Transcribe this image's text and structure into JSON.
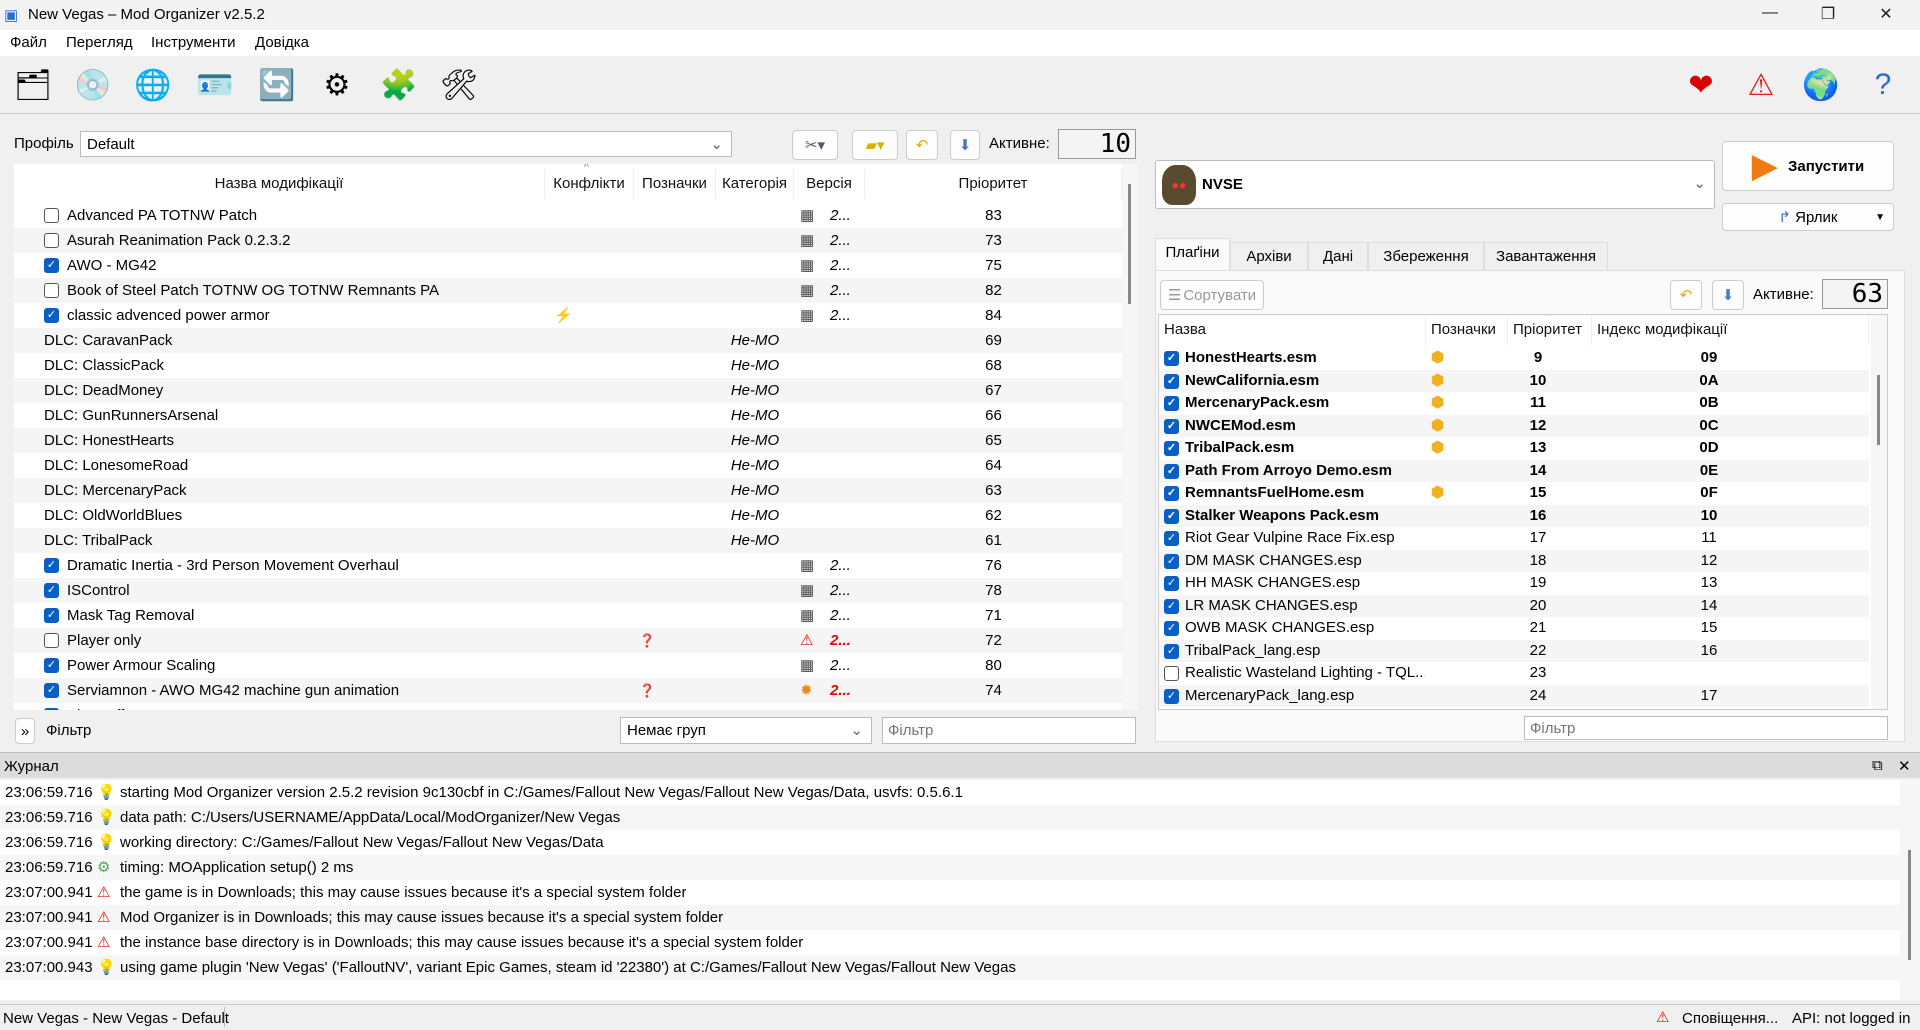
{
  "window": {
    "title": "New Vegas – Mod Organizer v2.5.2",
    "minimize": "—",
    "restore": "❐",
    "close": "✕"
  },
  "menu": [
    "Файл",
    "Перегляд",
    "Інструменти",
    "Довідка"
  ],
  "toolbar": {
    "left": [
      {
        "name": "instances-icon",
        "glyph": "🗂"
      },
      {
        "name": "install-mod-icon",
        "glyph": "💿"
      },
      {
        "name": "nexus-icon",
        "glyph": "🌐"
      },
      {
        "name": "profiles-icon",
        "glyph": "🪪"
      },
      {
        "name": "refresh-icon",
        "glyph": "🔄"
      },
      {
        "name": "executables-icon",
        "glyph": "⚙"
      },
      {
        "name": "tools-icon",
        "glyph": "🧩"
      },
      {
        "name": "settings-icon",
        "glyph": "🛠"
      }
    ],
    "right": [
      {
        "name": "endorse-icon",
        "glyph": "❤"
      },
      {
        "name": "notifications-icon",
        "glyph": "⚠"
      },
      {
        "name": "update-icon",
        "glyph": "🌍"
      },
      {
        "name": "help-icon",
        "glyph": "?"
      }
    ]
  },
  "profile": {
    "label": "Профіль",
    "value": "Default",
    "active_label": "Активне:",
    "active_count": "10"
  },
  "mods": {
    "columns": [
      "Назва модифікації",
      "Конфлікти",
      "Позначки",
      "Категорія",
      "Версія",
      "Пріоритет"
    ],
    "rows": [
      {
        "checked": false,
        "name": "Advanced PA TOTNW Patch",
        "version": "2...",
        "priority": "83"
      },
      {
        "checked": false,
        "name": "Asurah Reanimation Pack 0.2.3.2",
        "version": "2...",
        "priority": "73"
      },
      {
        "checked": true,
        "name": "AWO - MG42",
        "version": "2...",
        "priority": "75"
      },
      {
        "checked": false,
        "name": "Book of Steel Patch TOTNW OG TOTNW Remnants PA",
        "version": "2...",
        "priority": "82"
      },
      {
        "checked": true,
        "name": "classic advenced power armor",
        "conflict": "⚡",
        "version": "2...",
        "priority": "84"
      },
      {
        "dlc": true,
        "name": "DLC: CaravanPack",
        "category": "Не-MO",
        "priority": "69"
      },
      {
        "dlc": true,
        "name": "DLC: ClassicPack",
        "category": "Не-MO",
        "priority": "68"
      },
      {
        "dlc": true,
        "name": "DLC: DeadMoney",
        "category": "Не-MO",
        "priority": "67"
      },
      {
        "dlc": true,
        "name": "DLC: GunRunnersArsenal",
        "category": "Не-MO",
        "priority": "66"
      },
      {
        "dlc": true,
        "name": "DLC: HonestHearts",
        "category": "Не-MO",
        "priority": "65"
      },
      {
        "dlc": true,
        "name": "DLC: LonesomeRoad",
        "category": "Не-MO",
        "priority": "64"
      },
      {
        "dlc": true,
        "name": "DLC: MercenaryPack",
        "category": "Не-MO",
        "priority": "63"
      },
      {
        "dlc": true,
        "name": "DLC: OldWorldBlues",
        "category": "Не-MO",
        "priority": "62"
      },
      {
        "dlc": true,
        "name": "DLC: TribalPack",
        "category": "Не-MO",
        "priority": "61"
      },
      {
        "checked": true,
        "name": "Dramatic Inertia - 3rd Person Movement Overhaul",
        "version": "2...",
        "priority": "76"
      },
      {
        "checked": true,
        "name": "ISControl",
        "version": "2...",
        "priority": "78"
      },
      {
        "checked": true,
        "name": "Mask Tag Removal",
        "version": "2...",
        "priority": "71"
      },
      {
        "checked": false,
        "name": "Player only",
        "tag": "❓",
        "version": "2...",
        "warn": "⚠",
        "priority": "72"
      },
      {
        "checked": true,
        "name": "Power Armour Scaling",
        "version": "2...",
        "priority": "80"
      },
      {
        "checked": true,
        "name": "Serviamnon - AWO MG42 machine gun animation",
        "tag": "❓",
        "version": "2...",
        "warn": "✹",
        "priority": "74"
      },
      {
        "checked": true,
        "name": "ShowOff xNVSE",
        "version": "2...",
        "priority": "79"
      }
    ]
  },
  "filter_bar": {
    "expand": "»",
    "label": "Фільтр",
    "group": "Немає груп",
    "filter_placeholder": "Фільтр"
  },
  "executable": {
    "name": "NVSE",
    "run": "Запустити",
    "shortcut": "Ярлик"
  },
  "tabs": [
    "Плаґіни",
    "Архіви",
    "Дані",
    "Збереження",
    "Завантаження"
  ],
  "plugins": {
    "sort": "Сортувати",
    "active_label": "Активне:",
    "active_count": "63",
    "columns": [
      "Назва",
      "Позначки",
      "Пріоритет",
      "Індекс модифікації"
    ],
    "rows": [
      {
        "checked": true,
        "bold": true,
        "name": "HonestHearts.esm",
        "tag": true,
        "priority": "9",
        "index": "09"
      },
      {
        "checked": true,
        "bold": true,
        "name": "NewCalifornia.esm",
        "tag": true,
        "priority": "10",
        "index": "0A"
      },
      {
        "checked": true,
        "bold": true,
        "name": "MercenaryPack.esm",
        "tag": true,
        "priority": "11",
        "index": "0B"
      },
      {
        "checked": true,
        "bold": true,
        "name": "NWCEMod.esm",
        "tag": true,
        "priority": "12",
        "index": "0C"
      },
      {
        "checked": true,
        "bold": true,
        "name": "TribalPack.esm",
        "tag": true,
        "priority": "13",
        "index": "0D"
      },
      {
        "checked": true,
        "bold": true,
        "name": "Path From Arroyo Demo.esm",
        "priority": "14",
        "index": "0E"
      },
      {
        "checked": true,
        "bold": true,
        "name": "RemnantsFuelHome.esm",
        "tag": true,
        "priority": "15",
        "index": "0F"
      },
      {
        "checked": true,
        "bold": true,
        "name": "Stalker Weapons Pack.esm",
        "priority": "16",
        "index": "10"
      },
      {
        "checked": true,
        "name": "Riot Gear Vulpine Race Fix.esp",
        "priority": "17",
        "index": "11"
      },
      {
        "checked": true,
        "name": "DM MASK CHANGES.esp",
        "priority": "18",
        "index": "12"
      },
      {
        "checked": true,
        "name": "HH MASK CHANGES.esp",
        "priority": "19",
        "index": "13"
      },
      {
        "checked": true,
        "name": "LR MASK CHANGES.esp",
        "priority": "20",
        "index": "14"
      },
      {
        "checked": true,
        "name": "OWB MASK CHANGES.esp",
        "priority": "21",
        "index": "15"
      },
      {
        "checked": true,
        "name": "TribalPack_lang.esp",
        "priority": "22",
        "index": "16"
      },
      {
        "checked": false,
        "name": "Realistic Wasteland Lighting - TQL...",
        "priority": "23",
        "index": ""
      },
      {
        "checked": true,
        "name": "MercenaryPack_lang.esp",
        "priority": "24",
        "index": "17"
      }
    ],
    "filter_placeholder": "Фільтр"
  },
  "log": {
    "title": "Журнал",
    "entries": [
      {
        "time": "23:06:59.716",
        "level": "info",
        "text": "starting Mod Organizer version 2.5.2 revision 9c130cbf in C:/Games/Fallout New Vegas/Fallout New Vegas/Data, usvfs: 0.5.6.1"
      },
      {
        "time": "23:06:59.716",
        "level": "info",
        "text": "data path: C:/Users/USERNAME/AppData/Local/ModOrganizer/New Vegas"
      },
      {
        "time": "23:06:59.716",
        "level": "info",
        "text": "working directory: C:/Games/Fallout New Vegas/Fallout New Vegas/Data"
      },
      {
        "time": "23:06:59.716",
        "level": "debug",
        "text": "timing: MOApplication setup() 2 ms"
      },
      {
        "time": "23:07:00.941",
        "level": "warn",
        "text": "the game is in Downloads; this may cause issues because it's a special system folder"
      },
      {
        "time": "23:07:00.941",
        "level": "warn",
        "text": "Mod Organizer is in Downloads; this may cause issues because it's a special system folder"
      },
      {
        "time": "23:07:00.941",
        "level": "warn",
        "text": "the instance base directory is in Downloads; this may cause issues because it's a special system folder"
      },
      {
        "time": "23:07:00.943",
        "level": "info",
        "text": "using game plugin 'New Vegas' ('FalloutNV', variant Epic Games, steam id '22380') at C:/Games/Fallout New Vegas/Fallout New Vegas"
      }
    ]
  },
  "status": {
    "left": "New Vegas - New Vegas - Default",
    "notifications": "Сповіщення...",
    "api": "API: not logged in"
  }
}
